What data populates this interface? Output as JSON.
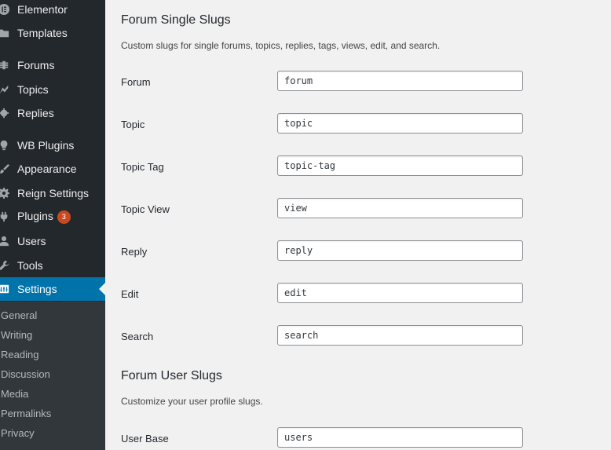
{
  "sidebar": {
    "items": [
      {
        "key": "elementor",
        "label": "Elementor",
        "icon": "elementor-icon"
      },
      {
        "key": "templates",
        "label": "Templates",
        "icon": "folder-icon"
      },
      {
        "key": "forums",
        "label": "Forums",
        "icon": "forums-icon"
      },
      {
        "key": "topics",
        "label": "Topics",
        "icon": "topics-icon"
      },
      {
        "key": "replies",
        "label": "Replies",
        "icon": "replies-icon"
      },
      {
        "key": "wb-plugins",
        "label": "WB Plugins",
        "icon": "lightbulb-icon"
      },
      {
        "key": "appearance",
        "label": "Appearance",
        "icon": "paintbrush-icon"
      },
      {
        "key": "reign-settings",
        "label": "Reign Settings",
        "icon": "gear-icon"
      },
      {
        "key": "plugins",
        "label": "Plugins",
        "icon": "plug-icon",
        "badge": "3"
      },
      {
        "key": "users",
        "label": "Users",
        "icon": "users-icon"
      },
      {
        "key": "tools",
        "label": "Tools",
        "icon": "wrench-icon"
      },
      {
        "key": "settings",
        "label": "Settings",
        "icon": "settings-icon",
        "active": true
      }
    ],
    "submenu": [
      "General",
      "Writing",
      "Reading",
      "Discussion",
      "Media",
      "Permalinks",
      "Privacy"
    ]
  },
  "colors": {
    "sidebar_bg": "#23282d",
    "submenu_bg": "#32373c",
    "active_bg": "#0073aa",
    "badge_bg": "#ca4a1f",
    "content_bg": "#f1f1f1"
  },
  "single_slugs": {
    "title": "Forum Single Slugs",
    "description": "Custom slugs for single forums, topics, replies, tags, views, edit, and search.",
    "fields": [
      {
        "label": "Forum",
        "value": "forum"
      },
      {
        "label": "Topic",
        "value": "topic"
      },
      {
        "label": "Topic Tag",
        "value": "topic-tag"
      },
      {
        "label": "Topic View",
        "value": "view"
      },
      {
        "label": "Reply",
        "value": "reply"
      },
      {
        "label": "Edit",
        "value": "edit"
      },
      {
        "label": "Search",
        "value": "search"
      }
    ]
  },
  "user_slugs": {
    "title": "Forum User Slugs",
    "description": "Customize your user profile slugs.",
    "fields": [
      {
        "label": "User Base",
        "value": "users"
      }
    ]
  }
}
